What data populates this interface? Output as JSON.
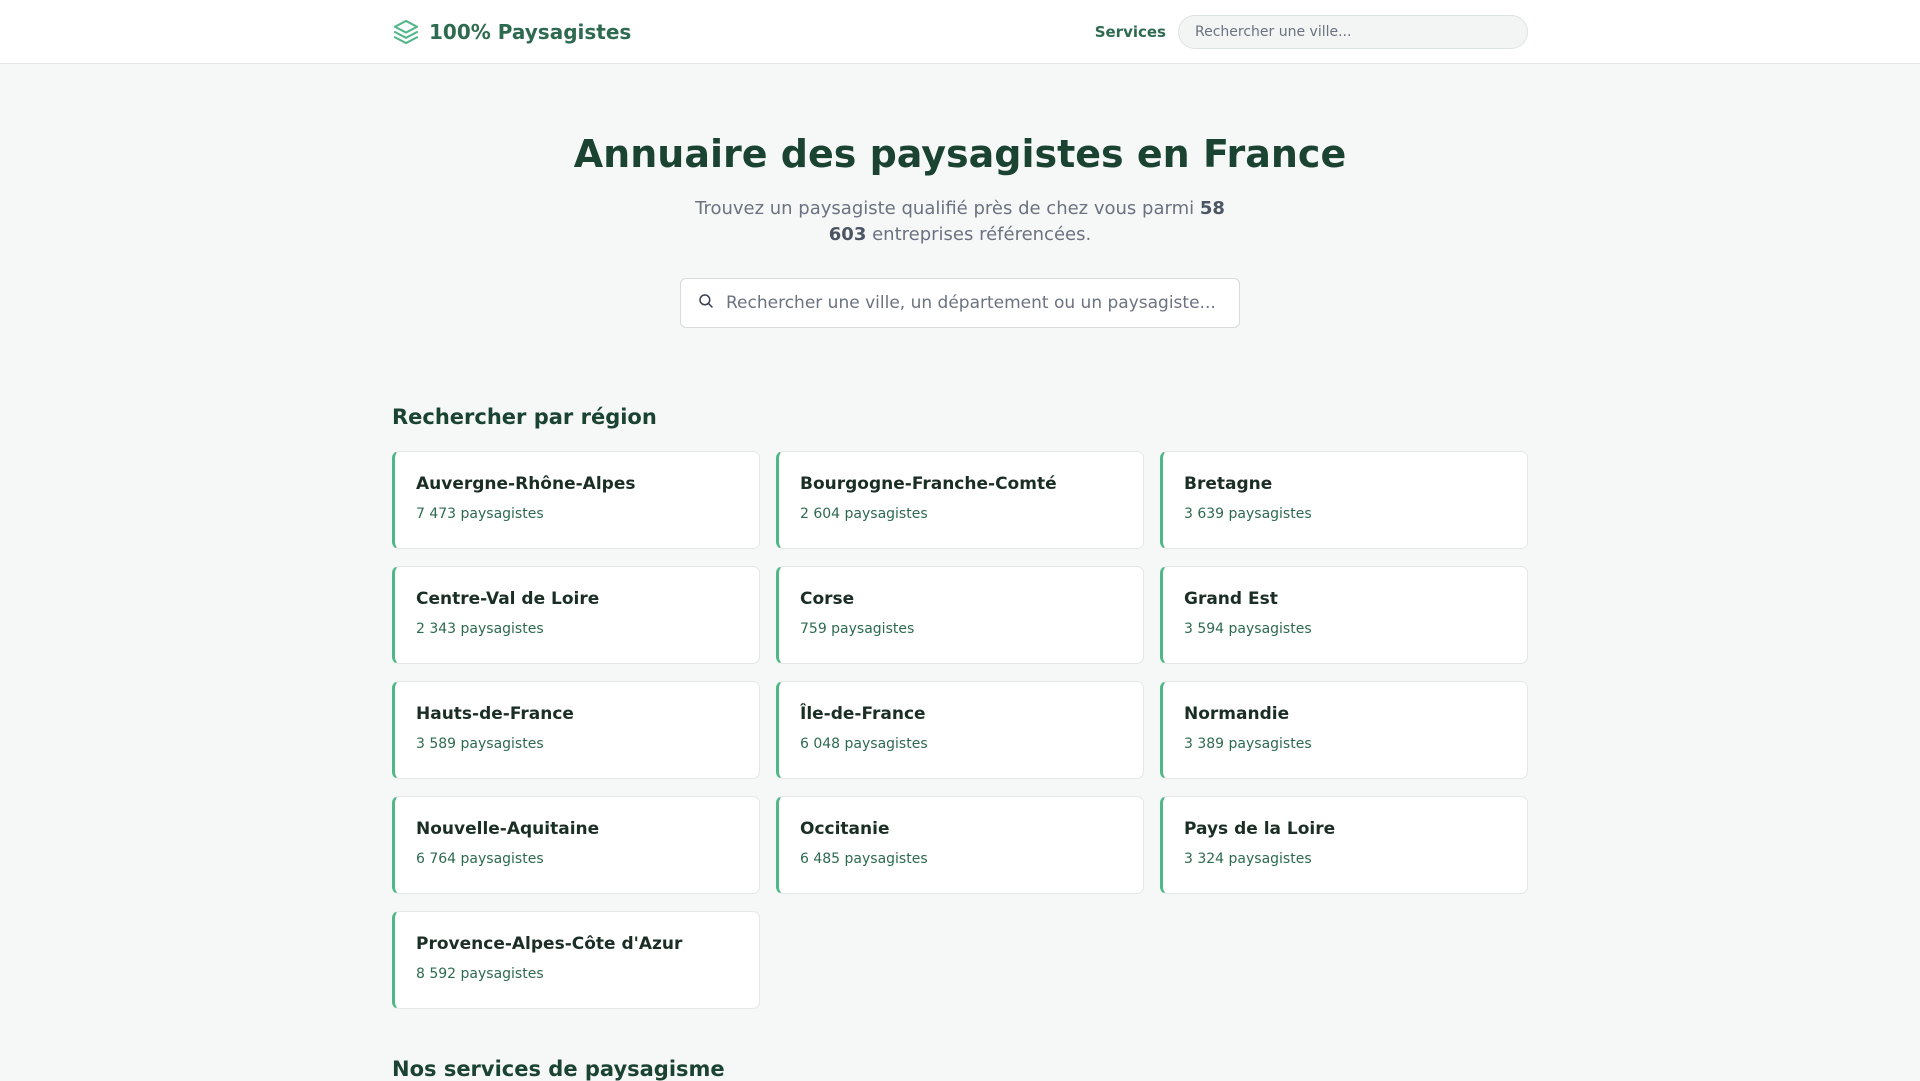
{
  "header": {
    "brand": "100% Paysagistes",
    "nav_services": "Services",
    "search_placeholder": "Rechercher une ville..."
  },
  "hero": {
    "title": "Annuaire des paysagistes en France",
    "subtitle_prefix": "Trouvez un paysagiste qualifié près de chez vous parmi ",
    "subtitle_count": "58 603",
    "subtitle_suffix": " entreprises référencées.",
    "search_placeholder": "Rechercher une ville, un département ou un paysagiste..."
  },
  "regions_section": {
    "title": "Rechercher par région",
    "items": [
      {
        "name": "Auvergne-Rhône-Alpes",
        "count": "7 473 paysagistes"
      },
      {
        "name": "Bourgogne-Franche-Comté",
        "count": "2 604 paysagistes"
      },
      {
        "name": "Bretagne",
        "count": "3 639 paysagistes"
      },
      {
        "name": "Centre-Val de Loire",
        "count": "2 343 paysagistes"
      },
      {
        "name": "Corse",
        "count": "759 paysagistes"
      },
      {
        "name": "Grand Est",
        "count": "3 594 paysagistes"
      },
      {
        "name": "Hauts-de-France",
        "count": "3 589 paysagistes"
      },
      {
        "name": "Île-de-France",
        "count": "6 048 paysagistes"
      },
      {
        "name": "Normandie",
        "count": "3 389 paysagistes"
      },
      {
        "name": "Nouvelle-Aquitaine",
        "count": "6 764 paysagistes"
      },
      {
        "name": "Occitanie",
        "count": "6 485 paysagistes"
      },
      {
        "name": "Pays de la Loire",
        "count": "3 324 paysagistes"
      },
      {
        "name": "Provence-Alpes-Côte d'Azur",
        "count": "8 592 paysagistes"
      }
    ]
  },
  "services_section": {
    "title": "Nos services de paysagisme"
  },
  "icons": {
    "brand": "layers-icon",
    "search": "search-icon"
  },
  "colors": {
    "brand_green": "#2d6a4f",
    "dark_green": "#1b4332",
    "accent_green": "#52b788",
    "background": "#f6f8f7"
  }
}
